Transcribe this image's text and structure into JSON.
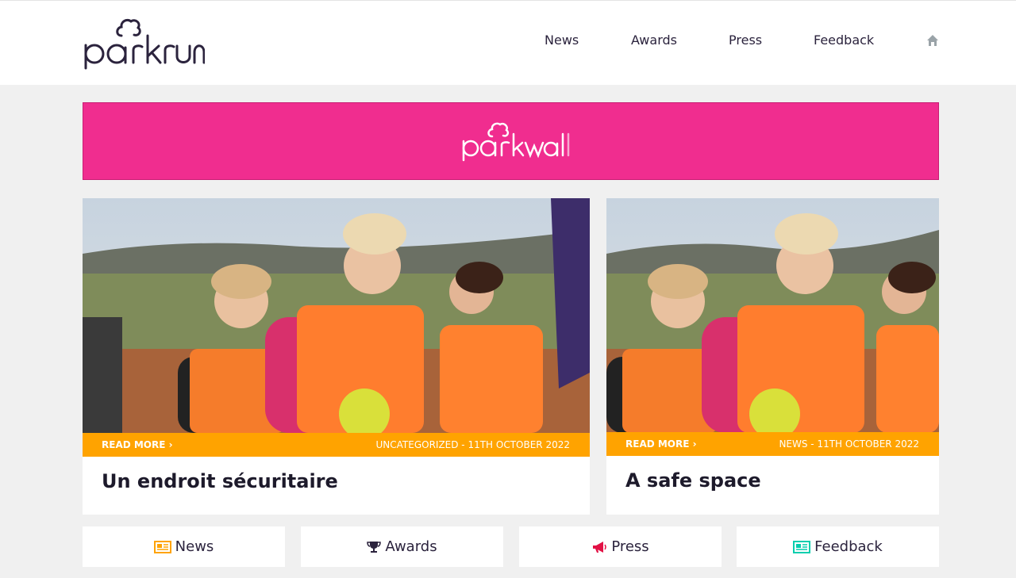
{
  "brand": {
    "name": "parkrun",
    "banner_name": "parkwalk"
  },
  "nav": {
    "items": [
      {
        "label": "News"
      },
      {
        "label": "Awards"
      },
      {
        "label": "Press"
      },
      {
        "label": "Feedback"
      }
    ],
    "home_icon": "home-icon"
  },
  "colors": {
    "banner": "#f02d8f",
    "accent": "#ffa300",
    "tile_news_icon": "#ffa300",
    "tile_awards_icon": "#2b233d",
    "tile_press_icon": "#e21145",
    "tile_feedback_icon": "#00ceae"
  },
  "cards": [
    {
      "read_more": "READ MORE ›",
      "meta": "UNCATEGORIZED - 11TH OCTOBER 2022",
      "title": "Un endroit sécuritaire"
    },
    {
      "read_more": "READ MORE ›",
      "meta": "NEWS - 11TH OCTOBER 2022",
      "title": "A safe space"
    }
  ],
  "tiles": [
    {
      "label": "News",
      "icon": "newspaper-icon"
    },
    {
      "label": "Awards",
      "icon": "trophy-icon"
    },
    {
      "label": "Press",
      "icon": "megaphone-icon"
    },
    {
      "label": "Feedback",
      "icon": "newspaper-icon"
    }
  ]
}
